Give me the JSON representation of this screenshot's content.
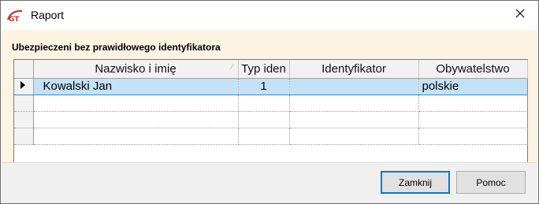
{
  "window": {
    "title": "Raport",
    "app_icon": "gt-logo-icon",
    "close_icon": "close-icon"
  },
  "section": {
    "label": "Ubezpieczeni bez prawidłowego identyfikatora"
  },
  "grid": {
    "columns": [
      "Nazwisko i imię",
      "Typ iden",
      "Identyfikator",
      "Obywatelstwo"
    ],
    "rows": [
      {
        "name": "Kowalski Jan",
        "type": "1",
        "identifier": "",
        "citizenship": "polskie",
        "selected": true
      },
      {
        "name": "",
        "type": "",
        "identifier": "",
        "citizenship": ""
      },
      {
        "name": "",
        "type": "",
        "identifier": "",
        "citizenship": ""
      },
      {
        "name": "",
        "type": "",
        "identifier": "",
        "citizenship": ""
      }
    ],
    "colors": {
      "selected_row": "#c4e2f5",
      "header": "#f2f2f2"
    }
  },
  "buttons": {
    "close_label": "Zamknij",
    "help_label": "Pomoc"
  },
  "colors": {
    "client_background": "#fcf3e3",
    "accent": "#0078d7"
  }
}
